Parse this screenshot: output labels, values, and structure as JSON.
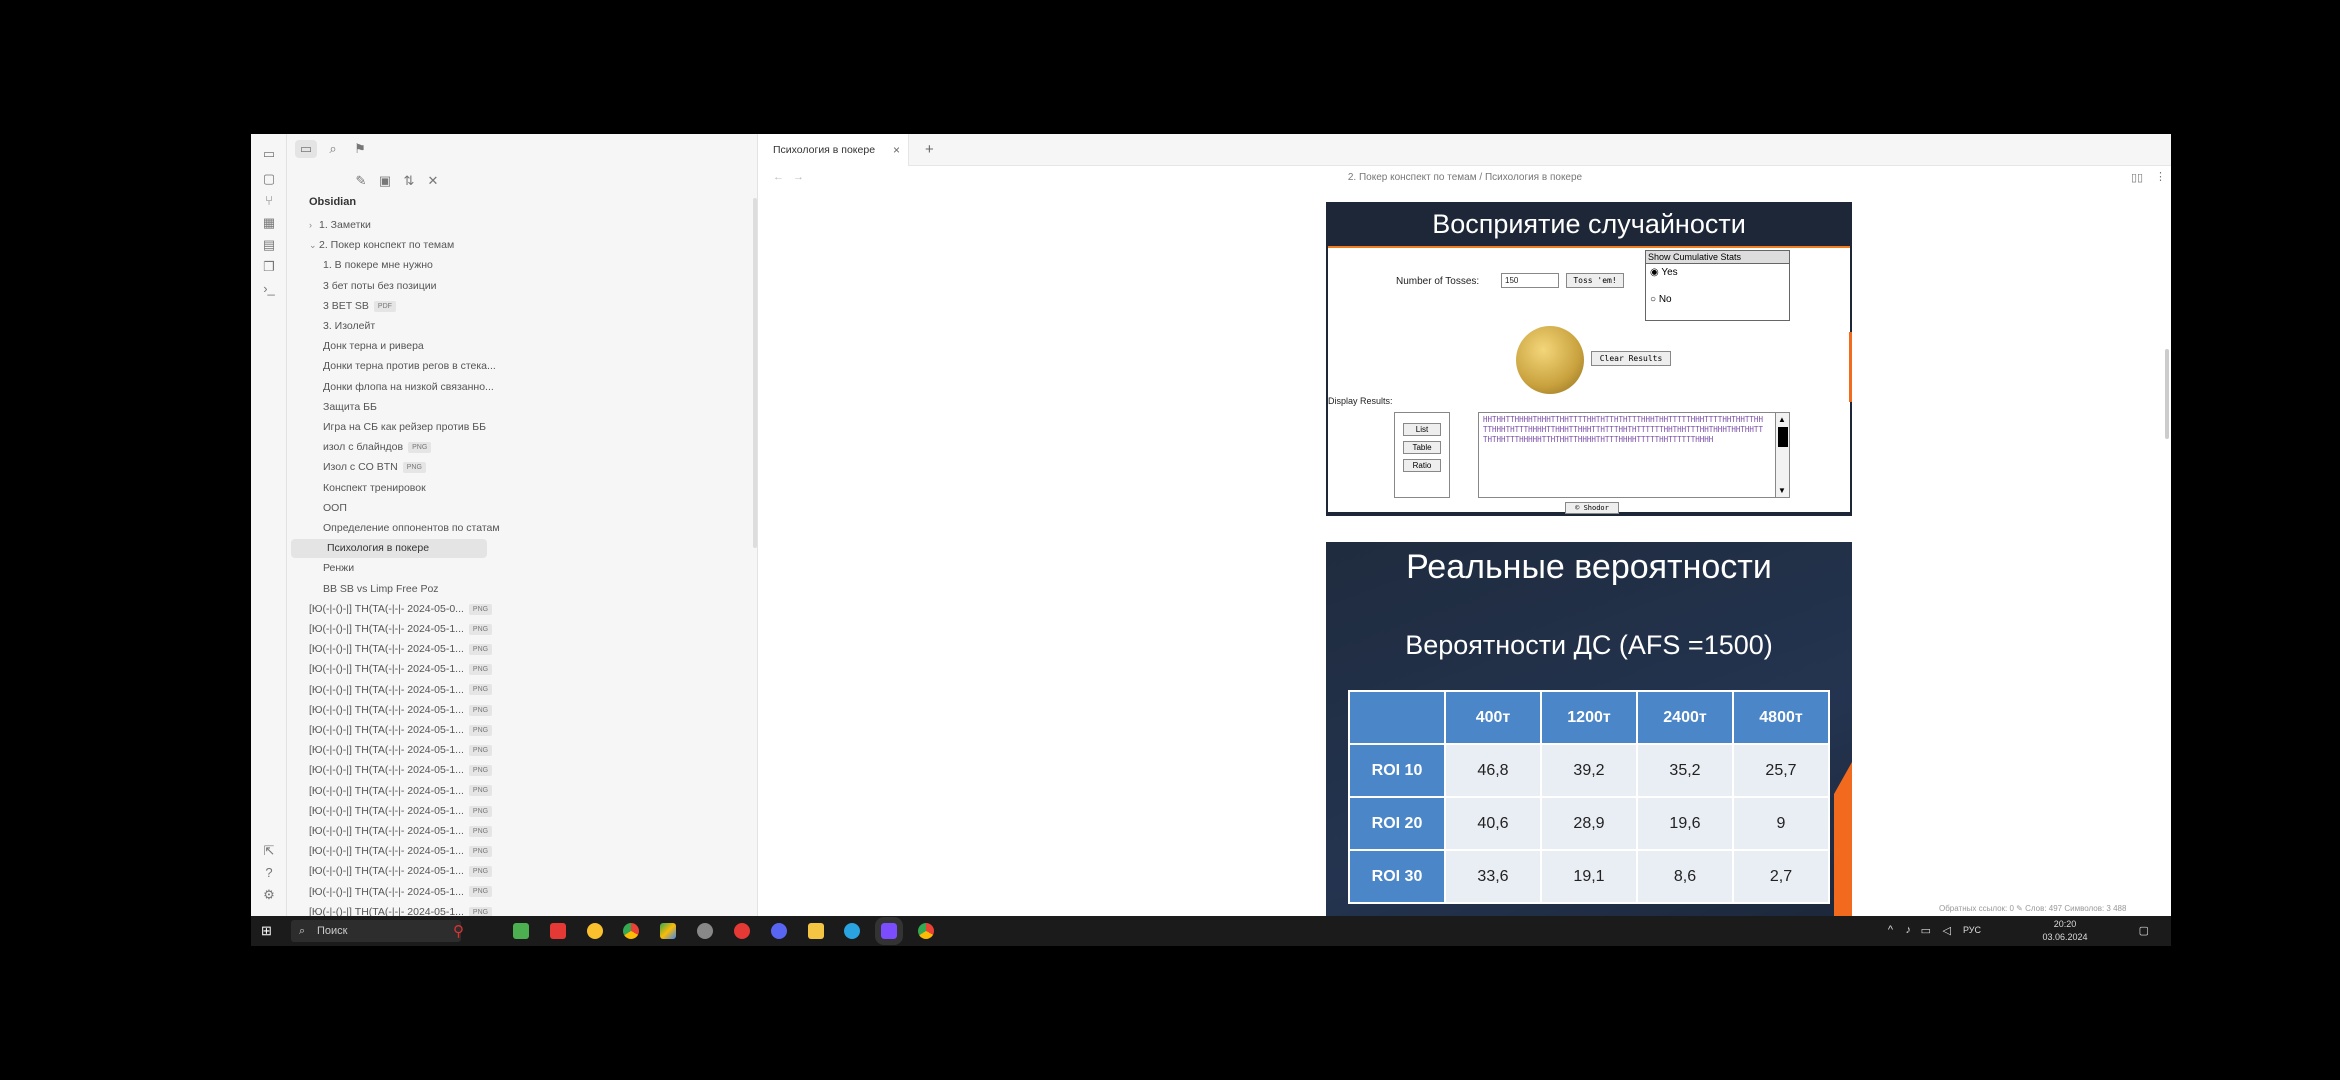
{
  "vault_name": "Obsidian",
  "tree": {
    "items": [
      {
        "label": "1. Заметки",
        "indent": 0,
        "chev": "›"
      },
      {
        "label": "2. Покер конспект по темам",
        "indent": 0,
        "chev": "⌄"
      },
      {
        "label": "1. В покере мне нужно",
        "indent": 1
      },
      {
        "label": "3 бет поты без позиции",
        "indent": 1
      },
      {
        "label": "3 BET SB",
        "indent": 1,
        "badge": "PDF"
      },
      {
        "label": "3. Изолейт",
        "indent": 1
      },
      {
        "label": "Донк терна и ривера",
        "indent": 1
      },
      {
        "label": "Донки терна против регов в стека...",
        "indent": 1
      },
      {
        "label": "Донки флопа на низкой связанно...",
        "indent": 1
      },
      {
        "label": "Защита ББ",
        "indent": 1
      },
      {
        "label": "Игра на СБ как рейзер против ББ",
        "indent": 1
      },
      {
        "label": "изол с блайндов",
        "indent": 1,
        "badge": "PNG"
      },
      {
        "label": "Изол с CO BTN",
        "indent": 1,
        "badge": "PNG"
      },
      {
        "label": "Конспект тренировок",
        "indent": 1
      },
      {
        "label": "ООП",
        "indent": 1
      },
      {
        "label": "Определение оппонентов по статам",
        "indent": 1
      },
      {
        "label": "Психология в покере",
        "indent": 1,
        "active": true
      },
      {
        "label": "Ренжи",
        "indent": 1
      },
      {
        "label": "BB SB vs Limp Free Poz",
        "indent": 1
      },
      {
        "label": "[Ю(-|-()-|] TH(TA(-|-|- 2024-05-0...",
        "indent": 0,
        "badge": "PNG"
      },
      {
        "label": "[Ю(-|-()-|] TH(TA(-|-|- 2024-05-1...",
        "indent": 0,
        "badge": "PNG"
      },
      {
        "label": "[Ю(-|-()-|] TH(TA(-|-|- 2024-05-1...",
        "indent": 0,
        "badge": "PNG"
      },
      {
        "label": "[Ю(-|-()-|] TH(TA(-|-|- 2024-05-1...",
        "indent": 0,
        "badge": "PNG"
      },
      {
        "label": "[Ю(-|-()-|] TH(TA(-|-|- 2024-05-1...",
        "indent": 0,
        "badge": "PNG"
      },
      {
        "label": "[Ю(-|-()-|] TH(TA(-|-|- 2024-05-1...",
        "indent": 0,
        "badge": "PNG"
      },
      {
        "label": "[Ю(-|-()-|] TH(TA(-|-|- 2024-05-1...",
        "indent": 0,
        "badge": "PNG"
      },
      {
        "label": "[Ю(-|-()-|] TH(TA(-|-|- 2024-05-1...",
        "indent": 0,
        "badge": "PNG"
      },
      {
        "label": "[Ю(-|-()-|] TH(TA(-|-|- 2024-05-1...",
        "indent": 0,
        "badge": "PNG"
      },
      {
        "label": "[Ю(-|-()-|] TH(TA(-|-|- 2024-05-1...",
        "indent": 0,
        "badge": "PNG"
      },
      {
        "label": "[Ю(-|-()-|] TH(TA(-|-|- 2024-05-1...",
        "indent": 0,
        "badge": "PNG"
      },
      {
        "label": "[Ю(-|-()-|] TH(TA(-|-|- 2024-05-1...",
        "indent": 0,
        "badge": "PNG"
      },
      {
        "label": "[Ю(-|-()-|] TH(TA(-|-|- 2024-05-1...",
        "indent": 0,
        "badge": "PNG"
      },
      {
        "label": "[Ю(-|-()-|] TH(TA(-|-|- 2024-05-1...",
        "indent": 0,
        "badge": "PNG"
      },
      {
        "label": "[Ю(-|-()-|] TH(TA(-|-|- 2024-05-1...",
        "indent": 0,
        "badge": "PNG"
      },
      {
        "label": "[Ю(-|-()-|] TH(TA(-|-|- 2024-05-1...",
        "indent": 0,
        "badge": "PNG"
      }
    ]
  },
  "tab": {
    "title": "Психология в покере",
    "close": "×",
    "new": "+"
  },
  "breadcrumb": "2. Покер конспект по темам / Психология в покере",
  "slide1": {
    "title": "Восприятие случайности",
    "tosses_label": "Number of Tosses:",
    "tosses_value": "150",
    "toss_button": "Toss 'em!",
    "stats_header": "Show Cumulative Stats",
    "yes": "Yes",
    "no": "No",
    "clear_button": "Clear Results",
    "display_label": "Display Results:",
    "list": "List",
    "table": "Table",
    "ratio": "Ratio",
    "results_text": "HHTHHTTHHHHTHHHTTHHTTTTHHTHTTHTHTTTHHHTHHTTTTTHHHTTTTHHTHHTTHHTTHHHTHTTTHHHHTTHHHTTHHHTTHTTTHHTHTTTTTTHHTHHTTTHHTHHHTHHTHHTTTHTHHTTTHHHHHTTHTHHTTHHHHTHTTTHHHHTTTTTHHTTTTTTHHHH",
    "shodor": "© Shodor"
  },
  "slide2": {
    "title": "Реальные вероятности",
    "subtitle": "Вероятности ДС (AFS =1500)",
    "columns": [
      "400т",
      "1200т",
      "2400т",
      "4800т"
    ],
    "rows": [
      {
        "label": "ROI 10",
        "values": [
          "46,8",
          "39,2",
          "35,2",
          "25,7"
        ]
      },
      {
        "label": "ROI 20",
        "values": [
          "40,6",
          "28,9",
          "19,6",
          "9"
        ]
      },
      {
        "label": "ROI 30",
        "values": [
          "33,6",
          "19,1",
          "8,6",
          "2,7"
        ]
      }
    ]
  },
  "status": "Обратных ссылок: 0  ✎  Слов: 497  Символов: 3 488",
  "taskbar": {
    "search": "Поиск",
    "lang": "РУС",
    "time": "20:20",
    "date": "03.06.2024"
  },
  "colors": {
    "slide_bg": "#1d2738",
    "table_header": "#4a86c8",
    "accent": "#f26a1e"
  }
}
